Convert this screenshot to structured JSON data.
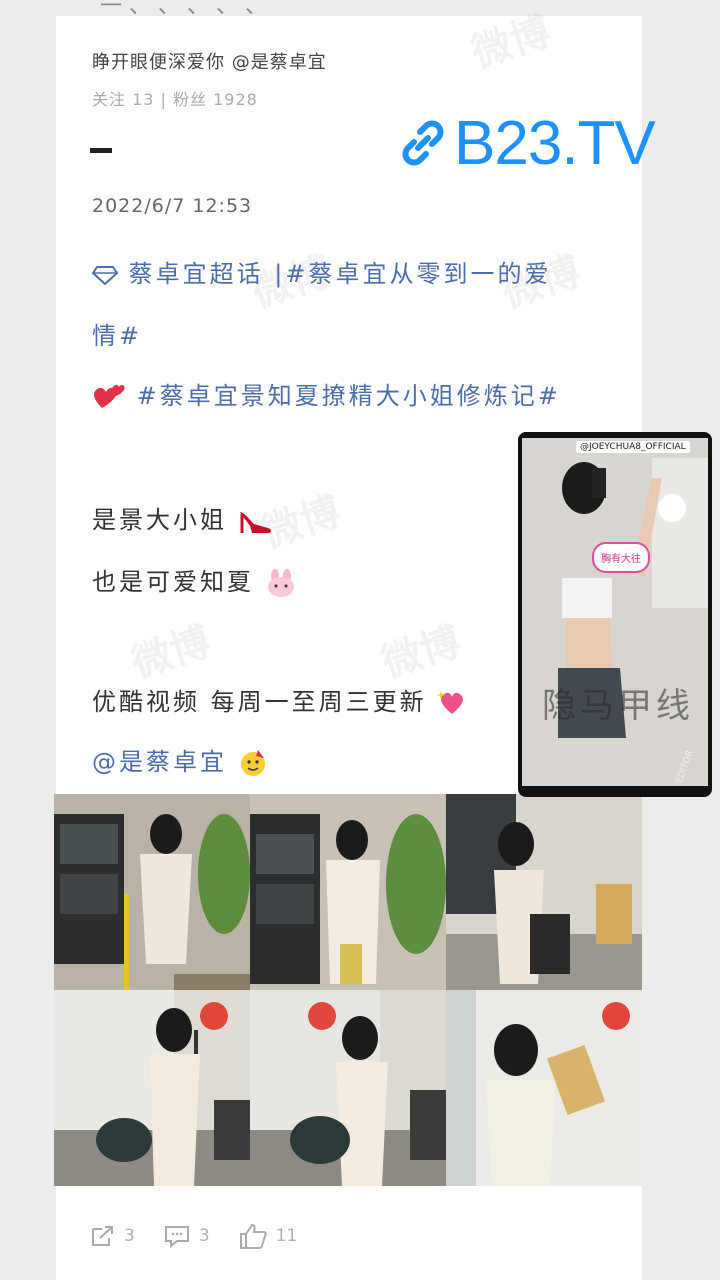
{
  "post": {
    "user_line": "睁开眼便深爱你  @是蔡卓宜",
    "stats_line": "关注 13 | 粉丝 1928",
    "date": "2022/6/7  12:53",
    "supertopic_line1": "蔡卓宜超话 |#蔡卓宜从零到一的爱",
    "supertopic_line2": "情#",
    "topic2": "#蔡卓宜景知夏撩精大小姐修炼记#",
    "line_a": "是景大小姐",
    "line_b": "也是可爱知夏",
    "line_c": "优酷视频 每周一至周三更新",
    "mention": "@是蔡卓宜"
  },
  "logo": {
    "text": "B23.TV",
    "color": "#1e90ff"
  },
  "overlay": {
    "tag": "@JOEYCHUA8_OFFICIAL",
    "bubble": "胸有大往",
    "caption": "隐马甲线",
    "badge": "EDITOR"
  },
  "actions": {
    "share_count": "3",
    "comment_count": "3",
    "like_count": "11"
  },
  "colors": {
    "topic": "#4d6da8",
    "accent_pink": "#e24c9f"
  }
}
